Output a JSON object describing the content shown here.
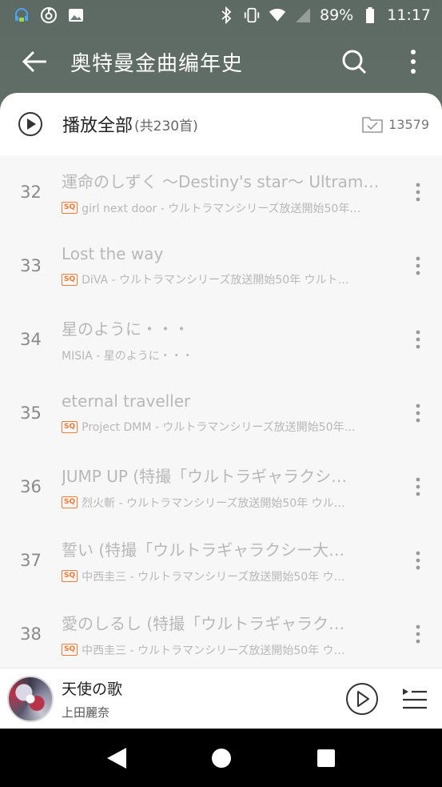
{
  "status_bar": {
    "battery": "89%",
    "time": "11:17",
    "left_icons": [
      "headset-app-icon",
      "netease-music-icon",
      "image-icon"
    ],
    "right_icons": [
      "bluetooth-icon",
      "vibrate-icon",
      "wifi-icon",
      "signal-icon",
      "battery-icon"
    ]
  },
  "app_bar": {
    "title": "奥特曼金曲编年史",
    "back_icon": "arrow-left-icon",
    "search_icon": "search-icon",
    "more_icon": "more-vertical-icon"
  },
  "play_all": {
    "label": "播放全部",
    "count": "(共230首)",
    "select_count": "13579"
  },
  "songs": [
    {
      "index": "32",
      "title": "運命のしずく ～Destiny's star～ Ultram…",
      "badge": "SQ",
      "subtitle": "girl next door - ウルトラマンシリーズ放送開始50年…"
    },
    {
      "index": "33",
      "title": "Lost the way",
      "badge": "SQ",
      "subtitle": "DiVA - ウルトラマンシリーズ放送開始50年 ウルト…"
    },
    {
      "index": "34",
      "title": "星のように・・・",
      "badge": "",
      "subtitle": "MISIA - 星のように・・・"
    },
    {
      "index": "35",
      "title": "eternal traveller",
      "badge": "SQ",
      "subtitle": "Project DMM - ウルトラマンシリーズ放送開始50年…"
    },
    {
      "index": "36",
      "title": "JUMP UP (特撮「ウルトラギャラクシ…",
      "badge": "SQ",
      "subtitle": "烈火斬 - ウルトラマンシリーズ放送開始50年 ウル…"
    },
    {
      "index": "37",
      "title": "誓い (特撮「ウルトラギャラクシー大…",
      "badge": "SQ",
      "subtitle": "中西圭三 - ウルトラマンシリーズ放送開始50年 ウ…"
    },
    {
      "index": "38",
      "title": "愛のしるし (特撮「ウルトラギャラク…",
      "badge": "SQ",
      "subtitle": "中西圭三 - ウルトラマンシリーズ放送開始50年 ウ…"
    }
  ],
  "player": {
    "title": "天使の歌",
    "artist": "上田麗奈"
  },
  "colors": {
    "header_bg": "#5d6a63",
    "accent_badge": "#f07b35",
    "muted_text": "#b8b8b8"
  }
}
